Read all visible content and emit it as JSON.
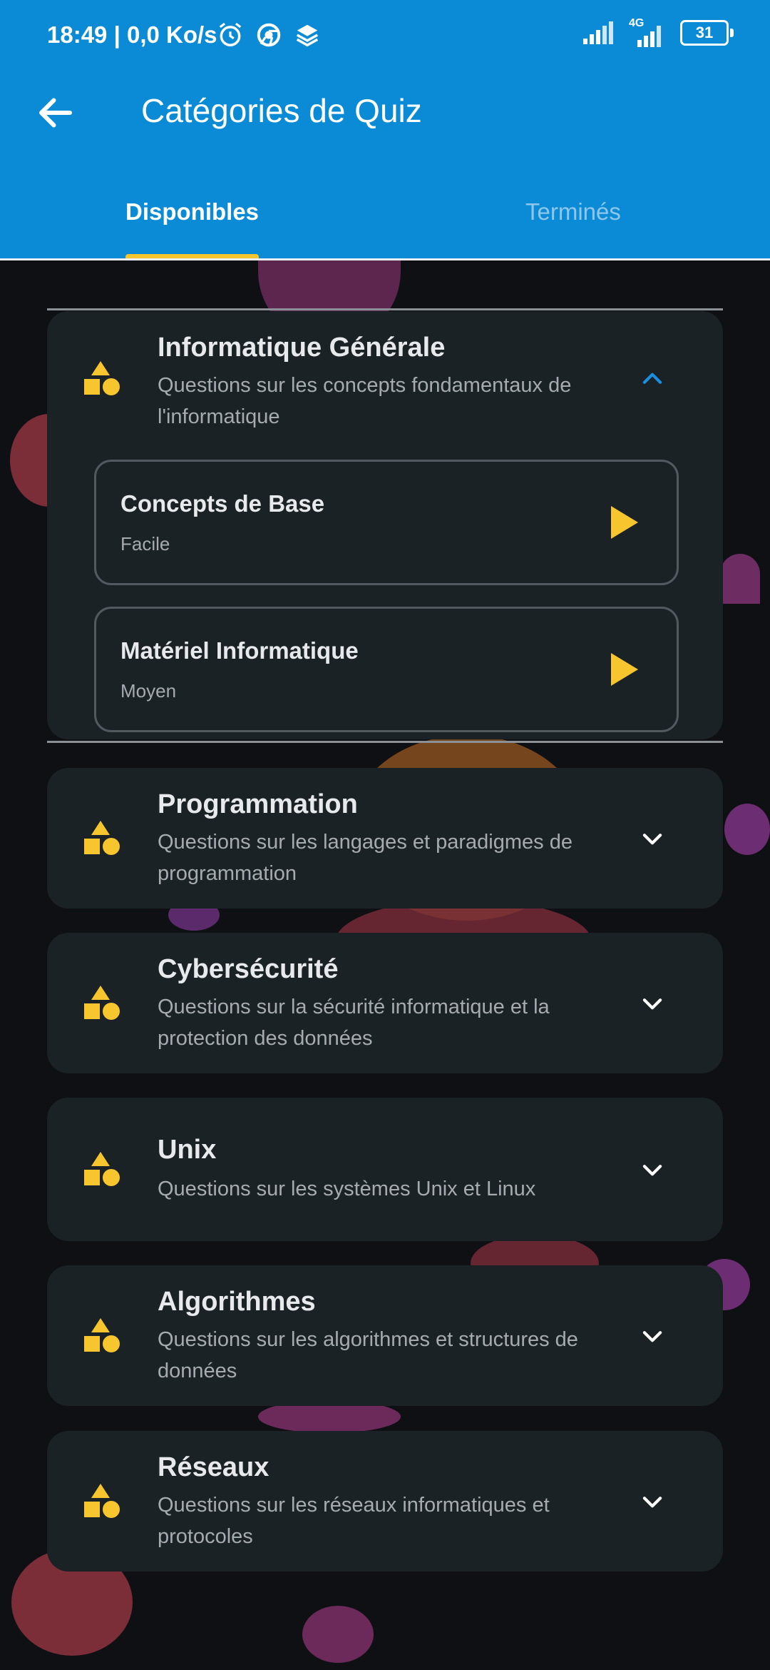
{
  "status_bar": {
    "time": "18:49 | 0,0 Ko/s",
    "network": "4G",
    "battery": "31"
  },
  "header": {
    "title": "Catégories de Quiz",
    "tabs": [
      {
        "label": "Disponibles",
        "active": true
      },
      {
        "label": "Terminés",
        "active": false
      }
    ]
  },
  "colors": {
    "accent": "#0b8bd5",
    "highlight": "#f7c62f",
    "card": "#1b2226",
    "background": "#0f1013"
  },
  "categories": [
    {
      "title": "Informatique Générale",
      "description": "Questions sur les concepts fondamentaux de l'informatique",
      "icon": "category-shapes-icon",
      "expanded": true,
      "quizzes": [
        {
          "title": "Concepts de Base",
          "level": "Facile"
        },
        {
          "title": "Matériel Informatique",
          "level": "Moyen"
        }
      ]
    },
    {
      "title": "Programmation",
      "description": "Questions sur les langages et paradigmes de programmation",
      "icon": "category-shapes-icon",
      "expanded": false
    },
    {
      "title": "Cybersécurité",
      "description": "Questions sur la sécurité informatique et la protection des données",
      "icon": "category-shapes-icon",
      "expanded": false
    },
    {
      "title": "Unix",
      "description": "Questions sur les systèmes Unix et Linux",
      "icon": "category-shapes-icon",
      "expanded": false
    },
    {
      "title": "Algorithmes",
      "description": "Questions sur les algorithmes et structures de données",
      "icon": "category-shapes-icon",
      "expanded": false
    },
    {
      "title": "Réseaux",
      "description": "Questions sur les réseaux informatiques et protocoles",
      "icon": "category-shapes-icon",
      "expanded": false
    }
  ]
}
